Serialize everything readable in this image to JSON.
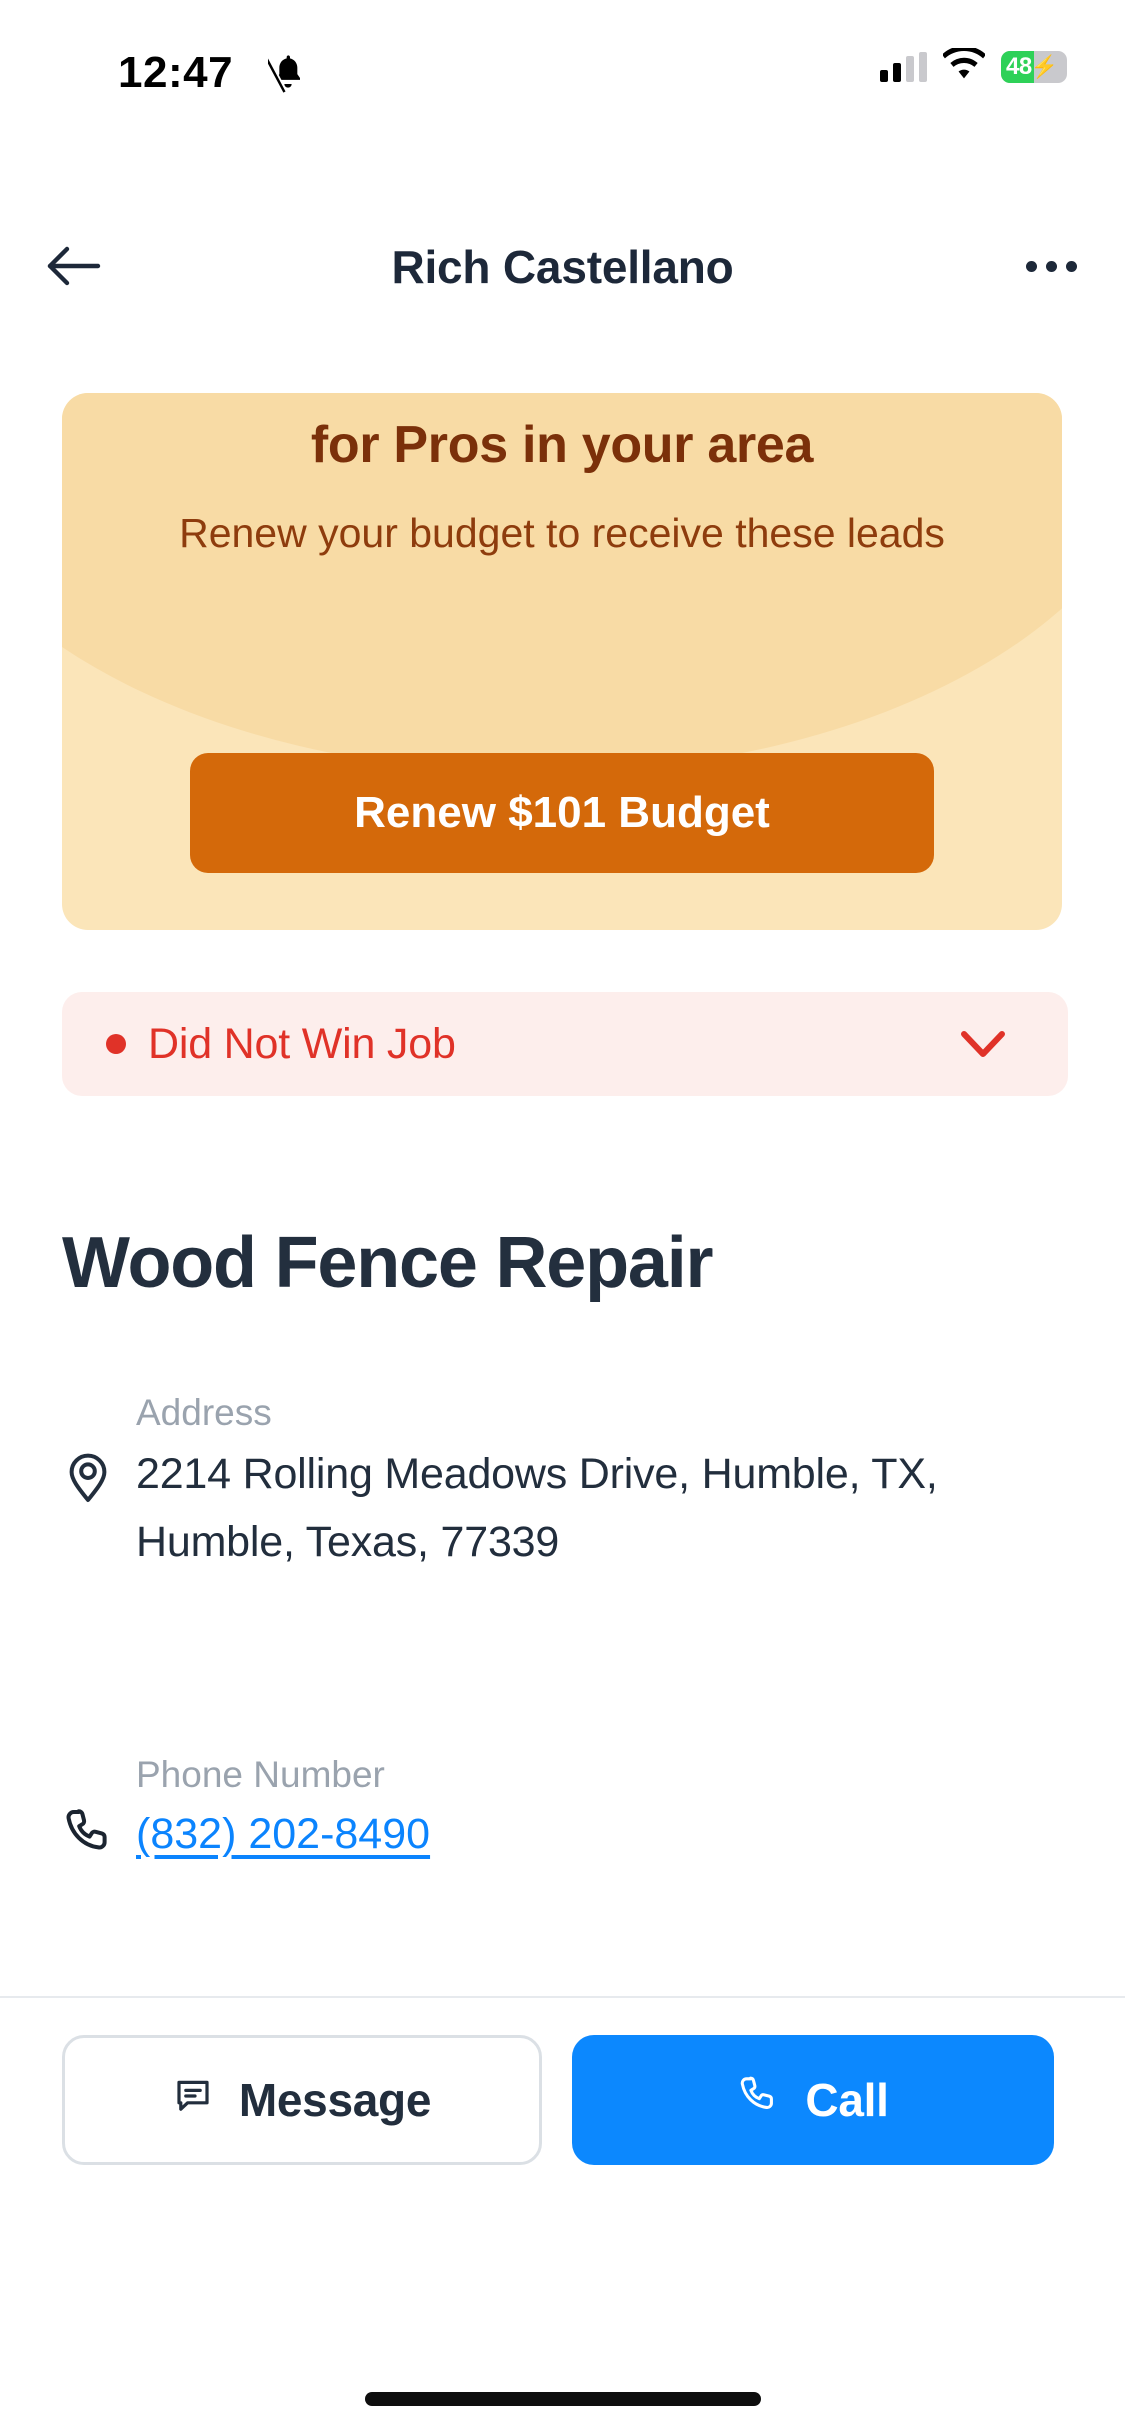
{
  "status_bar": {
    "time": "12:47",
    "bell_icon": "bell-muted-icon",
    "signal_icon": "cellular-signal-icon",
    "wifi_icon": "wifi-icon",
    "battery_level": "48",
    "battery_charging_icon": "charging-bolt-icon",
    "battery_color": "#2ed158"
  },
  "nav": {
    "back_icon": "back-arrow-icon",
    "title": "Rich Castellano",
    "more_icon": "more-options-icon"
  },
  "promo": {
    "title": "for Pros in your area",
    "subtitle": "Renew your budget to receive these leads",
    "button_label": "Renew $101 Budget",
    "card_bg": "#fbe5b9",
    "button_bg": "#d4690a",
    "title_color": "#7b300a"
  },
  "status": {
    "label": "Did Not Win Job",
    "dot_icon": "status-dot-icon",
    "chevron_icon": "chevron-down-icon",
    "color": "#e03228",
    "bg": "#fdeeec"
  },
  "job": {
    "title": "Wood Fence Repair"
  },
  "details": {
    "address": {
      "icon": "map-pin-icon",
      "label": "Address",
      "value": "2214 Rolling Meadows Drive, Humble, TX,  Humble, Texas, 77339"
    },
    "phone": {
      "icon": "phone-icon",
      "label": "Phone Number",
      "value": "(832) 202-8490",
      "link_color": "#0b84fe"
    }
  },
  "actions": {
    "message_label": "Message",
    "message_icon": "message-bubble-icon",
    "call_label": "Call",
    "call_icon": "phone-icon",
    "call_bg": "#0c88fe"
  }
}
